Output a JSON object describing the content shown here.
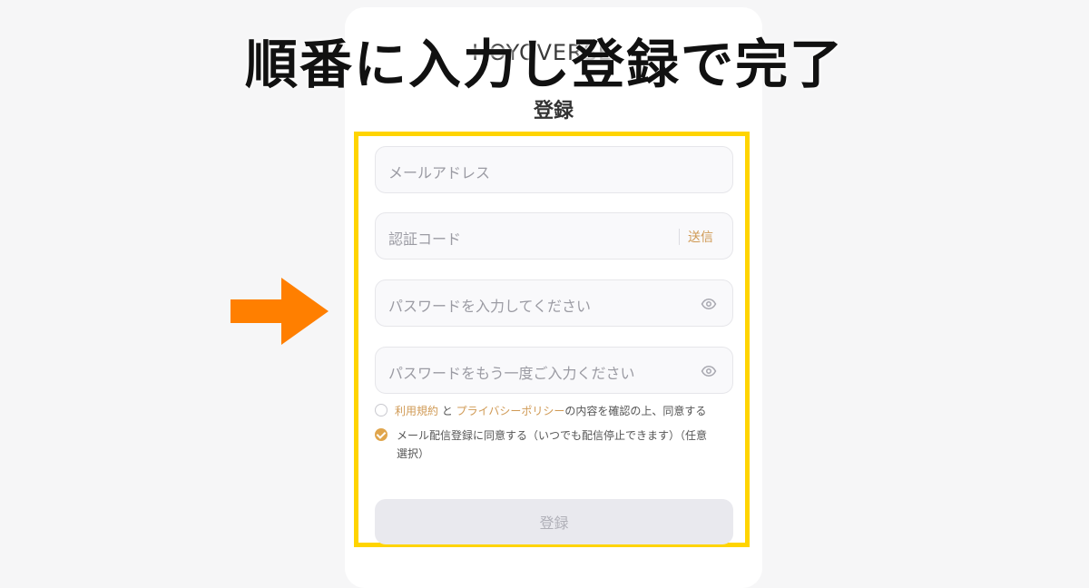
{
  "headline": "順番に入力し登録で完了",
  "brand_text": "HOYOVERSE",
  "form": {
    "title": "登録",
    "email_placeholder": "メールアドレス",
    "code_placeholder": "認証コード",
    "send_label": "送信",
    "password_placeholder": "パスワードを入力してください",
    "password_confirm_placeholder": "パスワードをもう一度ご入力ください",
    "terms": {
      "link1": "利用規約",
      "and": " と ",
      "link2": "プライバシーポリシー",
      "rest": "の内容を確認の上、同意する",
      "checked": false
    },
    "newsletter": {
      "line1": "メール配信登録に同意する（いつでも配信停止できます）（任意",
      "line2": "選択）",
      "checked": true
    },
    "submit_label": "登録"
  },
  "colors": {
    "highlight": "#ffd400",
    "accent": "#d09a55",
    "arrow": "#ff7f00"
  },
  "icons": [
    "eye-icon",
    "checkbox-icon",
    "arrow-icon"
  ]
}
